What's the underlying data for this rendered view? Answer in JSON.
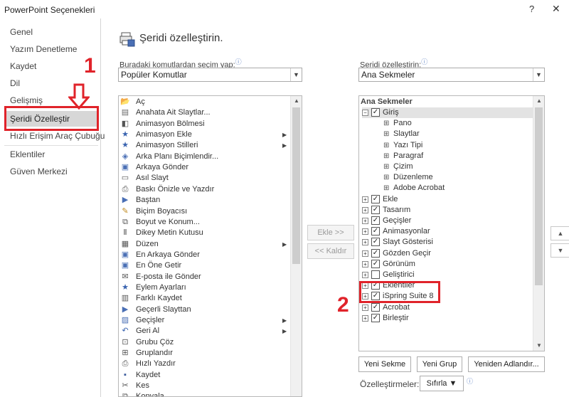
{
  "window": {
    "title": "PowerPoint Seçenekleri",
    "help": "?",
    "close": "✕"
  },
  "nav": {
    "items": [
      {
        "label": "Genel"
      },
      {
        "label": "Yazım Denetleme"
      },
      {
        "label": "Kaydet"
      },
      {
        "label": "Dil"
      },
      {
        "label": "Gelişmiş"
      },
      {
        "label": "Şeridi Özelleştir"
      },
      {
        "label": "Hızlı Erişim Araç Çubuğu"
      },
      {
        "label": "Eklentiler"
      },
      {
        "label": "Güven Merkezi"
      }
    ]
  },
  "header": {
    "title": "Şeridi özelleştirin."
  },
  "left_panel": {
    "label": "Buradaki komutlardan seçim yap:",
    "selected": "Popüler Komutlar",
    "commands": [
      {
        "label": "Aç",
        "icon": "folder-open-icon",
        "sub": false
      },
      {
        "label": "Anahata Ait Slaytlar...",
        "icon": "slides-icon",
        "sub": false
      },
      {
        "label": "Animasyon Bölmesi",
        "icon": "animation-pane-icon",
        "sub": false
      },
      {
        "label": "Animasyon Ekle",
        "icon": "star-icon",
        "sub": true
      },
      {
        "label": "Animasyon Stilleri",
        "icon": "star-icon",
        "sub": true
      },
      {
        "label": "Arka Planı Biçimlendir...",
        "icon": "paint-bucket-icon",
        "sub": false
      },
      {
        "label": "Arkaya Gönder",
        "icon": "send-back-icon",
        "sub": false
      },
      {
        "label": "Asıl Slayt",
        "icon": "slide-icon",
        "sub": false
      },
      {
        "label": "Baskı Önizle ve Yazdır",
        "icon": "print-preview-icon",
        "sub": false
      },
      {
        "label": "Baştan",
        "icon": "slideshow-icon",
        "sub": false
      },
      {
        "label": "Biçim Boyacısı",
        "icon": "format-painter-icon",
        "sub": false
      },
      {
        "label": "Boyut ve Konum...",
        "icon": "size-icon",
        "sub": false
      },
      {
        "label": "Dikey Metin Kutusu",
        "icon": "vertical-textbox-icon",
        "sub": false
      },
      {
        "label": "Düzen",
        "icon": "layout-icon",
        "sub": true
      },
      {
        "label": "En Arkaya Gönder",
        "icon": "send-to-back-icon",
        "sub": false
      },
      {
        "label": "En Öne Getir",
        "icon": "bring-to-front-icon",
        "sub": false
      },
      {
        "label": "E-posta ile Gönder",
        "icon": "email-icon",
        "sub": false
      },
      {
        "label": "Eylem Ayarları",
        "icon": "action-icon",
        "sub": false
      },
      {
        "label": "Farklı Kaydet",
        "icon": "save-as-icon",
        "sub": false
      },
      {
        "label": "Geçerli Slayttan",
        "icon": "slideshow-icon",
        "sub": false
      },
      {
        "label": "Geçişler",
        "icon": "transitions-icon",
        "sub": true
      },
      {
        "label": "Geri Al",
        "icon": "undo-icon",
        "sub": true
      },
      {
        "label": "Grubu Çöz",
        "icon": "ungroup-icon",
        "sub": false
      },
      {
        "label": "Gruplandır",
        "icon": "group-icon",
        "sub": false
      },
      {
        "label": "Hızlı Yazdır",
        "icon": "quick-print-icon",
        "sub": false
      },
      {
        "label": "Kaydet",
        "icon": "save-icon",
        "sub": false
      },
      {
        "label": "Kes",
        "icon": "cut-icon",
        "sub": false
      },
      {
        "label": "Kopyala",
        "icon": "copy-icon",
        "sub": false
      }
    ]
  },
  "right_panel": {
    "label": "Şeridi özelleştirin:",
    "selected": "Ana Sekmeler",
    "tree_header": "Ana Sekmeler",
    "tree": [
      {
        "label": "Giriş",
        "level": 0,
        "expander": "⊟",
        "checked": true,
        "selected": true
      },
      {
        "label": "Pano",
        "level": 1,
        "expander": "⊞"
      },
      {
        "label": "Slaytlar",
        "level": 1,
        "expander": "⊞"
      },
      {
        "label": "Yazı Tipi",
        "level": 1,
        "expander": "⊞"
      },
      {
        "label": "Paragraf",
        "level": 1,
        "expander": "⊞"
      },
      {
        "label": "Çizim",
        "level": 1,
        "expander": "⊞"
      },
      {
        "label": "Düzenleme",
        "level": 1,
        "expander": "⊞"
      },
      {
        "label": "Adobe Acrobat",
        "level": 1,
        "expander": "⊞"
      },
      {
        "label": "Ekle",
        "level": 0,
        "expander": "⊞",
        "checked": true
      },
      {
        "label": "Tasarım",
        "level": 0,
        "expander": "⊞",
        "checked": true
      },
      {
        "label": "Geçişler",
        "level": 0,
        "expander": "⊞",
        "checked": true
      },
      {
        "label": "Animasyonlar",
        "level": 0,
        "expander": "⊞",
        "checked": true
      },
      {
        "label": "Slayt Gösterisi",
        "level": 0,
        "expander": "⊞",
        "checked": true
      },
      {
        "label": "Gözden Geçir",
        "level": 0,
        "expander": "⊞",
        "checked": true
      },
      {
        "label": "Görünüm",
        "level": 0,
        "expander": "⊞",
        "checked": true
      },
      {
        "label": "Geliştirici",
        "level": 0,
        "expander": "⊞",
        "checked": false
      },
      {
        "label": "Eklentiler",
        "level": 0,
        "expander": "⊞",
        "checked": true
      },
      {
        "label": "iSpring Suite 8",
        "level": 0,
        "expander": "⊞",
        "checked": true
      },
      {
        "label": "Acrobat",
        "level": 0,
        "expander": "⊞",
        "checked": true
      },
      {
        "label": "Birleştir",
        "level": 0,
        "expander": "⊞",
        "checked": true
      }
    ]
  },
  "middle": {
    "add": "Ekle >>",
    "remove": "<< Kaldır"
  },
  "bottom": {
    "new_tab": "Yeni Sekme",
    "new_group": "Yeni Grup",
    "rename": "Yeniden Adlandır...",
    "customizations_label": "Özelleştirmeler:",
    "reset": "Sıfırla ▼"
  },
  "annotations": {
    "one": "1",
    "two": "2"
  },
  "colors": {
    "annotation": "#e0232a",
    "nav_active": "#d7d7d7"
  }
}
